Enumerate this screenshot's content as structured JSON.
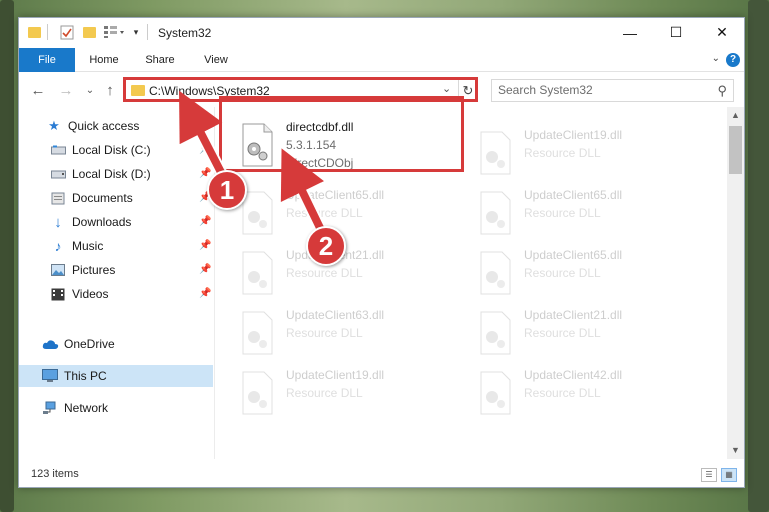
{
  "window": {
    "title": "System32",
    "controls": {
      "minimize": "—",
      "maximize": "☐",
      "close": "✕"
    }
  },
  "ribbon": {
    "tabs": [
      {
        "label": "File"
      },
      {
        "label": "Home"
      },
      {
        "label": "Share"
      },
      {
        "label": "View"
      }
    ],
    "help": "?"
  },
  "address": {
    "path": "C:\\Windows\\System32",
    "search_placeholder": "Search System32"
  },
  "nav": {
    "items": [
      {
        "label": "Quick access",
        "icon": "star-icon",
        "pinned": false
      },
      {
        "label": "Local Disk (C:)",
        "icon": "drive-icon",
        "pinned": true
      },
      {
        "label": "Local Disk (D:)",
        "icon": "drive-icon",
        "pinned": true
      },
      {
        "label": "Documents",
        "icon": "documents-icon",
        "pinned": true
      },
      {
        "label": "Downloads",
        "icon": "download-icon",
        "pinned": true
      },
      {
        "label": "Music",
        "icon": "music-icon",
        "pinned": true
      },
      {
        "label": "Pictures",
        "icon": "pictures-icon",
        "pinned": true
      },
      {
        "label": "Videos",
        "icon": "videos-icon",
        "pinned": true
      },
      {
        "label": "OneDrive",
        "icon": "cloud-icon",
        "pinned": false
      },
      {
        "label": "This PC",
        "icon": "computer-icon",
        "pinned": false,
        "selected": true
      },
      {
        "label": "Network",
        "icon": "network-icon",
        "pinned": false
      }
    ]
  },
  "files": [
    {
      "name": "directcdbf.dll",
      "line2": "5.3.1.154",
      "line3": "DirectCDObj",
      "highlighted": true
    },
    {
      "name": "UpdateClient19.dll",
      "line2": "Resource DLL",
      "line3": ""
    },
    {
      "name": "UpdateClient65.dll",
      "line2": "Resource DLL",
      "line3": ""
    },
    {
      "name": "UpdateClient65.dll",
      "line2": "Resource DLL",
      "line3": ""
    },
    {
      "name": "UpdateClient21.dll",
      "line2": "Resource DLL",
      "line3": ""
    },
    {
      "name": "UpdateClient65.dll",
      "line2": "Resource DLL",
      "line3": ""
    },
    {
      "name": "UpdateClient63.dll",
      "line2": "Resource DLL",
      "line3": ""
    },
    {
      "name": "UpdateClient21.dll",
      "line2": "Resource DLL",
      "line3": ""
    },
    {
      "name": "UpdateClient19.dll",
      "line2": "Resource DLL",
      "line3": ""
    },
    {
      "name": "UpdateClient42.dll",
      "line2": "Resource DLL",
      "line3": ""
    }
  ],
  "status": {
    "item_count": "123 items"
  },
  "annotations": {
    "callout_1": "1",
    "callout_2": "2",
    "color": "#d63a3a"
  }
}
